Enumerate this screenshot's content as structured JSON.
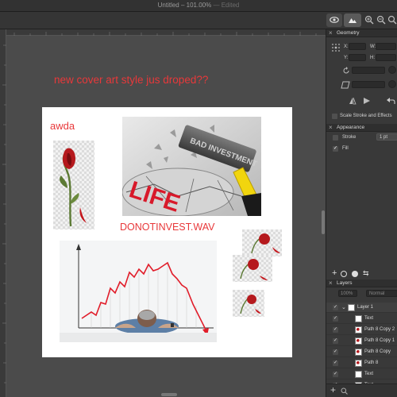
{
  "window": {
    "title": "Untitled – 101.00%",
    "status": "— Edited"
  },
  "canvas": {
    "floating_text": "new cover art style jus droped??",
    "artboard": {
      "awda_text": "awda",
      "donot_text": "DONOTINVEST.WAV",
      "hammer_words": [
        "BAD INVESTMENT",
        "LIFE"
      ]
    }
  },
  "panel": {
    "geometry": {
      "title": "Geometry",
      "x_label": "X:",
      "y_label": "Y:",
      "w_label": "W:",
      "h_label": "H:"
    },
    "appearance": {
      "scale_label": "Scale Stroke and Effects",
      "title": "Appearance",
      "stroke_label": "Stroke",
      "stroke_value": "1 pt",
      "fill_label": "Fill"
    },
    "layers": {
      "title": "Layers",
      "opacity": "100%",
      "blend": "Normal",
      "items": [
        {
          "name": "Layer 1",
          "group": true
        },
        {
          "name": "Text",
          "group": false
        },
        {
          "name": "Path 8 Copy 2",
          "group": false
        },
        {
          "name": "Path 8 Copy 1",
          "group": false
        },
        {
          "name": "Path 8 Copy",
          "group": false
        },
        {
          "name": "Path 8",
          "group": false
        },
        {
          "name": "Text",
          "group": false
        },
        {
          "name": "Text",
          "group": false
        }
      ]
    }
  },
  "colors": {
    "accent_red": "#e8383a",
    "panel_bg": "#393939",
    "canvas_bg": "#4b4b4b"
  }
}
